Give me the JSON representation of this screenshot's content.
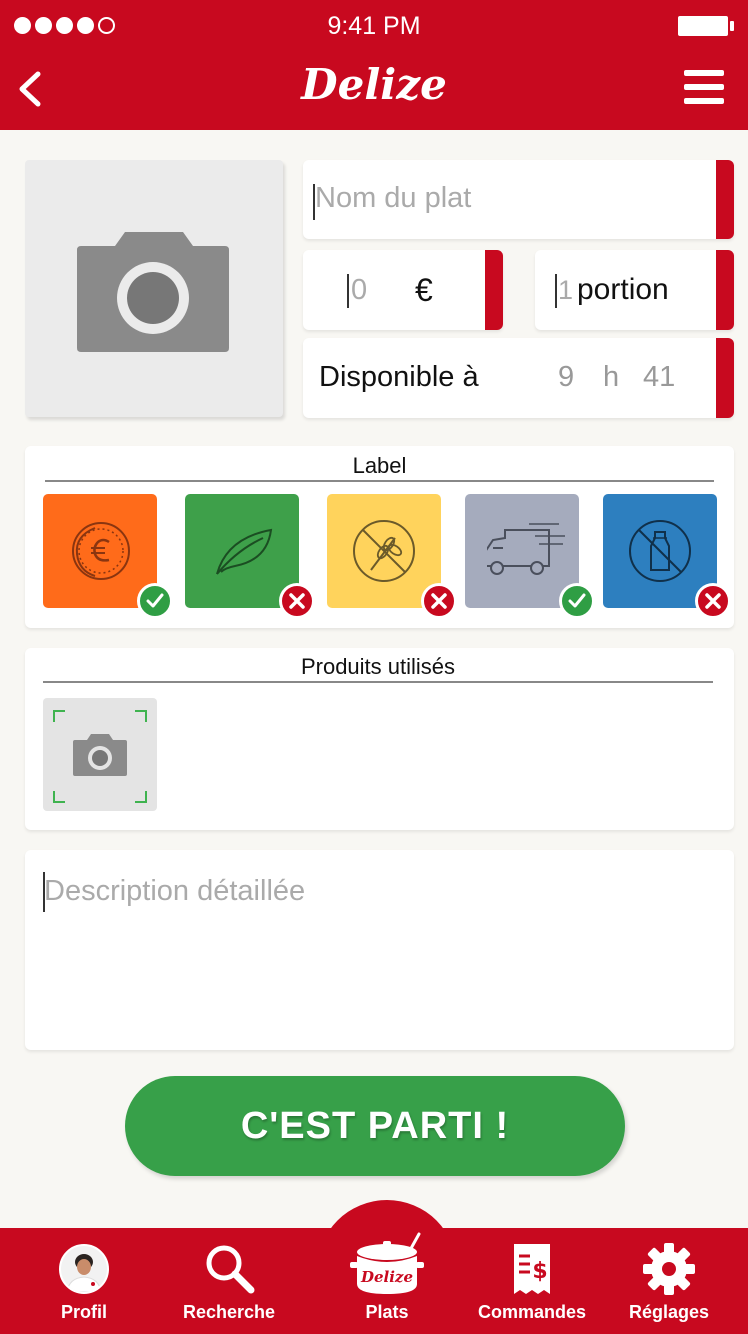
{
  "status_bar": {
    "time": "9:41 PM",
    "signal_dots": 5,
    "signal_filled": 4
  },
  "header": {
    "brand": "Delize",
    "back_icon": "chevron-left-icon",
    "menu_icon": "hamburger-menu-icon"
  },
  "form": {
    "photo_icon": "camera-icon",
    "name_placeholder": "Nom du plat",
    "price_value": "0",
    "currency": "€",
    "portion_value": "1",
    "portion_unit": "portion",
    "available_label": "Disponible à",
    "available_hour": "9",
    "available_sep": "h",
    "available_minute": "41",
    "description_placeholder": "Description détaillée"
  },
  "label_section": {
    "title": "Label",
    "tiles": [
      {
        "name": "euro-coin",
        "icon": "euro-coin-icon",
        "color": "#ff6b1a",
        "state": "checked"
      },
      {
        "name": "leaf",
        "icon": "leaf-icon",
        "color": "#3ea04a",
        "state": "unchecked"
      },
      {
        "name": "gluten-free",
        "icon": "no-wheat-icon",
        "color": "#ffd35c",
        "state": "unchecked"
      },
      {
        "name": "delivery",
        "icon": "delivery-van-icon",
        "color": "#a5abbd",
        "state": "checked"
      },
      {
        "name": "lactose-free",
        "icon": "no-milk-icon",
        "color": "#2d7fbf",
        "state": "unchecked"
      }
    ]
  },
  "products_section": {
    "title": "Produits utilisés",
    "scan_icon": "camera-scan-icon"
  },
  "submit_button": "C'EST PARTI !",
  "tabbar": {
    "items": [
      {
        "label": "Profil",
        "icon": "avatar"
      },
      {
        "label": "Recherche",
        "icon": "search-icon"
      },
      {
        "label": "Plats",
        "icon": "cooking-pot-icon",
        "pot_text": "Delize"
      },
      {
        "label": "Commandes",
        "icon": "receipt-dollar-icon"
      },
      {
        "label": "Réglages",
        "icon": "gear-icon"
      }
    ]
  },
  "colors": {
    "primary_red": "#c8091f",
    "go_green": "#37a049",
    "background": "#f8f7f3"
  }
}
